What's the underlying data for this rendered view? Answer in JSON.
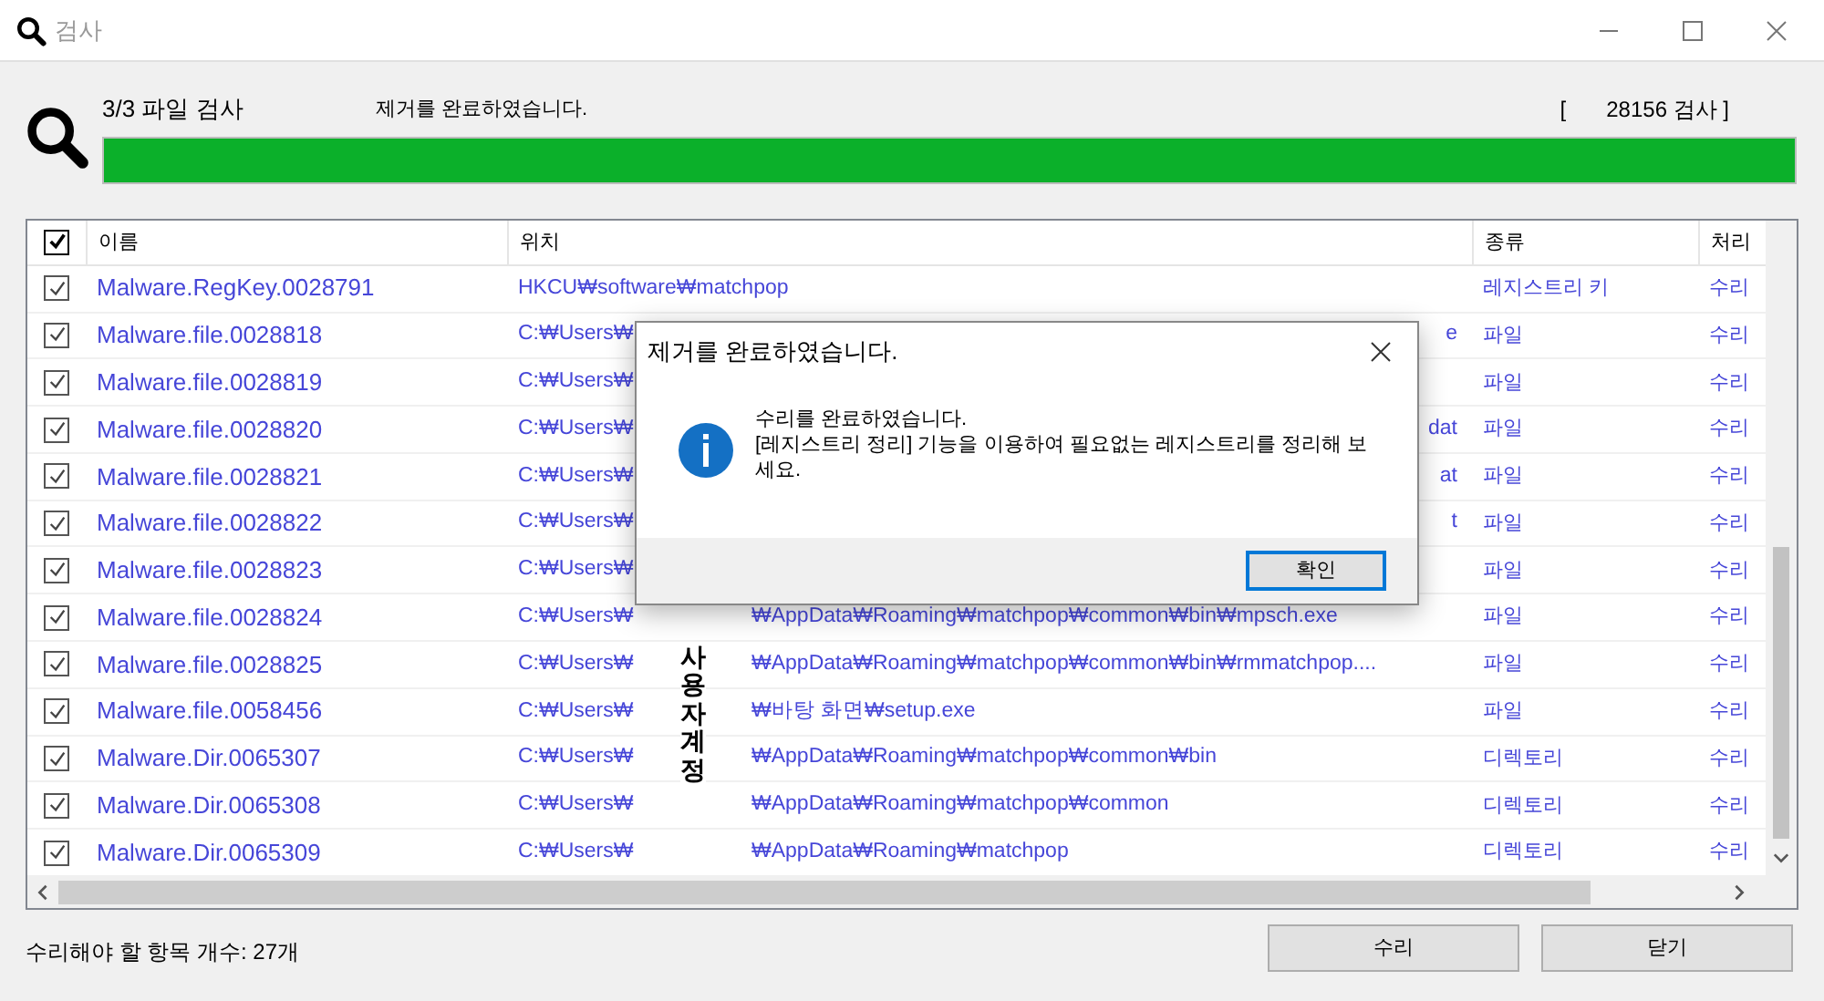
{
  "window": {
    "title": "검사"
  },
  "scan": {
    "title": "3/3 파일 검사",
    "status": "제거를 완료하였습니다.",
    "count_open": "[",
    "count": "28156 검사 ]",
    "level": 1
  },
  "table": {
    "all_checked": true,
    "columns": [
      "이름",
      "위치",
      "종류",
      "처리"
    ],
    "rows": [
      {
        "checked": true,
        "name": "Malware.RegKey.0028791",
        "location": "HKCU₩software₩matchpop",
        "location_tail": "",
        "type": "레지스트리 키",
        "action": "수리"
      },
      {
        "checked": true,
        "name": "Malware.file.0028818",
        "location": "C:₩Users₩",
        "location_tail": "e",
        "type": "파일",
        "action": "수리"
      },
      {
        "checked": true,
        "name": "Malware.file.0028819",
        "location": "C:₩Users₩",
        "location_tail": "",
        "type": "파일",
        "action": "수리"
      },
      {
        "checked": true,
        "name": "Malware.file.0028820",
        "location": "C:₩Users₩",
        "location_tail": "dat",
        "type": "파일",
        "action": "수리"
      },
      {
        "checked": true,
        "name": "Malware.file.0028821",
        "location": "C:₩Users₩",
        "location_tail": "at",
        "type": "파일",
        "action": "수리"
      },
      {
        "checked": true,
        "name": "Malware.file.0028822",
        "location": "C:₩Users₩",
        "location_tail": "t",
        "type": "파일",
        "action": "수리"
      },
      {
        "checked": true,
        "name": "Malware.file.0028823",
        "location": "C:₩Users₩",
        "location_tail": "",
        "type": "파일",
        "action": "수리"
      },
      {
        "checked": true,
        "name": "Malware.file.0028824",
        "location": "C:₩Users₩",
        "location_tail": "₩AppData₩Roaming₩matchpop₩common₩bin₩mpsch.exe",
        "type": "파일",
        "action": "수리"
      },
      {
        "checked": true,
        "name": "Malware.file.0028825",
        "location": "C:₩Users₩",
        "location_tail": "₩AppData₩Roaming₩matchpop₩common₩bin₩rmmatchpop....",
        "type": "파일",
        "action": "수리"
      },
      {
        "checked": true,
        "name": "Malware.file.0058456",
        "location": "C:₩Users₩",
        "location_tail": "₩바탕 화면₩setup.exe",
        "type": "파일",
        "action": "수리"
      },
      {
        "checked": true,
        "name": "Malware.Dir.0065307",
        "location": "C:₩Users₩",
        "location_tail": "₩AppData₩Roaming₩matchpop₩common₩bin",
        "type": "디렉토리",
        "action": "수리"
      },
      {
        "checked": true,
        "name": "Malware.Dir.0065308",
        "location": "C:₩Users₩",
        "location_tail": "₩AppData₩Roaming₩matchpop₩common",
        "type": "디렉토리",
        "action": "수리"
      },
      {
        "checked": true,
        "name": "Malware.Dir.0065309",
        "location": "C:₩Users₩",
        "location_tail": "₩AppData₩Roaming₩matchpop",
        "type": "디렉토리",
        "action": "수리"
      }
    ]
  },
  "annotation": "사용자계정",
  "footer": {
    "summary": "수리해야 할 항목 개수: 27개",
    "buttons": [
      "수리",
      "닫기"
    ]
  },
  "dialog": {
    "title": "제거를 완료하였습니다.",
    "message": [
      "수리를 완료하였습니다.",
      "[레지스트리 정리] 기능을 이용하여 필요없는 레지스트리를 정리해 보세요."
    ],
    "button": "확인"
  }
}
